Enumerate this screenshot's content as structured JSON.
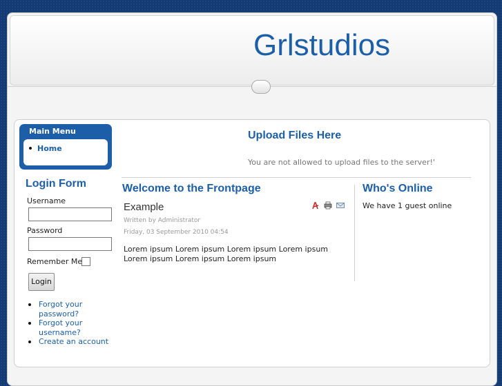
{
  "site": {
    "title": "Grlstudios"
  },
  "main_menu": {
    "title": "Main Menu",
    "items": [
      {
        "label": "Home"
      }
    ]
  },
  "login_form": {
    "title": "Login Form",
    "username_label": "Username",
    "password_label": "Password",
    "remember_label": "Remember Me",
    "login_button": "Login",
    "links": [
      "Forgot your password?",
      "Forgot your username?",
      "Create an account"
    ]
  },
  "upload": {
    "title": "Upload Files Here",
    "message": "You are not allowed to upload files to the server!'"
  },
  "frontpage": {
    "title": "Welcome to the Frontpage",
    "article": {
      "title": "Example",
      "written_by": "Written by Administrator",
      "date": "Friday, 03 September 2010 04:54",
      "body": "Lorem ipsum Lorem ipsum Lorem ipsum Lorem ipsum Lorem ipsum Lorem ipsum Lorem ipsum"
    },
    "icons": [
      "pdf-icon",
      "print-icon",
      "email-icon"
    ]
  },
  "whos_online": {
    "title": "Who's Online",
    "text": "We have 1 guest online"
  },
  "colors": {
    "brand": "#1c5fa8",
    "background": "#123a73"
  }
}
